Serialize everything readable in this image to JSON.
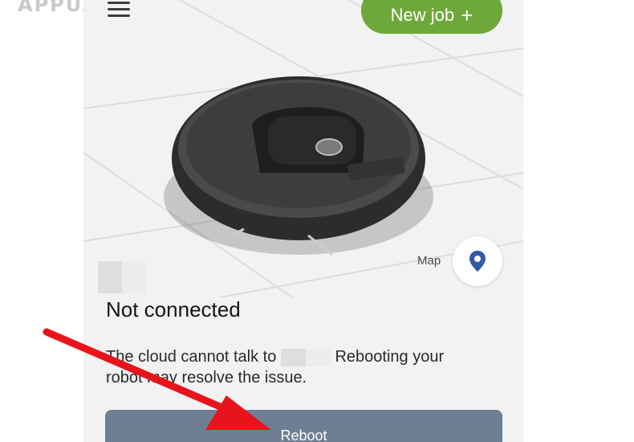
{
  "watermark": "APPUALS",
  "header": {
    "new_job_label": "New job",
    "new_job_icon": "plus-icon"
  },
  "map": {
    "label": "Map",
    "icon": "location-pin-icon"
  },
  "status": {
    "title": "Not connected",
    "message_part1": "The cloud cannot talk to",
    "message_part2": "Rebooting your robot may resolve the issue."
  },
  "actions": {
    "reboot_label": "Reboot"
  },
  "colors": {
    "new_job": "#6fa83a",
    "reboot": "#6e7f94",
    "pin": "#2f5aa8",
    "arrow": "#e8141c"
  }
}
